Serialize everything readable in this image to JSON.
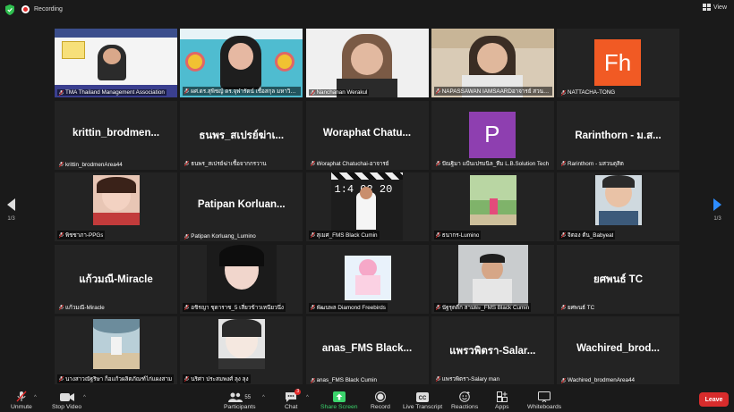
{
  "topbar": {
    "recording_label": "Recording",
    "view_label": "View"
  },
  "pager": {
    "left_label": "1/3",
    "right_label": "1/3"
  },
  "tiles": [
    {
      "label": "TMA Thailand Management Association",
      "kind": "video-presenter",
      "muted": true
    },
    {
      "label": "ผศ.ดร.สุพิชญ์ ดร.จุฬารัตน์ เชื้อสกุล มหาวิทยา...",
      "kind": "video-woman",
      "muted": true
    },
    {
      "label": "Nanchanan Werakul",
      "kind": "video-werakul",
      "muted": true
    },
    {
      "label": "NAPASSAWAN IAMSAARDอาจารย์ สวนดุสิต",
      "kind": "video-napassawan",
      "muted": true
    },
    {
      "label": "NATTACHA-TONG",
      "kind": "avatar",
      "avatar_text": "Fh",
      "avatar_color": "#f15a24",
      "muted": true
    },
    {
      "label": "krittin_brodmenArea44",
      "kind": "name",
      "big": "krittin_brodmen...",
      "muted": true
    },
    {
      "label": "ธนพร_สเปรย์ฆ่าเชื้อจากกรวาน",
      "kind": "name",
      "big": "ธนพร_สเปรย์ฆ่าเ...",
      "muted": true
    },
    {
      "label": "Woraphat Chatuchai-อาจารย์",
      "kind": "name",
      "big": "Woraphat  Chatu...",
      "muted": true
    },
    {
      "label": "ปัณฐิมา แป้นเปรมนิล_ทีม L.B.Solution Tech",
      "kind": "avatar",
      "avatar_text": "P",
      "avatar_color": "#8e3fb0",
      "muted": true
    },
    {
      "label": "Rarinthorn - มสวนดุสิต",
      "kind": "name",
      "big": "Rarinthorn - ม.ส...",
      "muted": true
    },
    {
      "label": "พิชชาภา-PPGs",
      "kind": "photo",
      "photo": "girl",
      "muted": true
    },
    {
      "label": "Patipan Korluang_Lumino",
      "kind": "name",
      "big": "Patipan  Korluan...",
      "muted": true
    },
    {
      "label": "สุเมศ_FMS Black Cumin",
      "kind": "photo",
      "photo": "clapper",
      "muted": true
    },
    {
      "label": "ธนากร-Lumino",
      "kind": "photo",
      "photo": "park",
      "muted": true
    },
    {
      "label": "จิตอง ต้น_Babyeat",
      "kind": "photo",
      "photo": "boy",
      "muted": true
    },
    {
      "label": "แก้วมณี-Miracle",
      "kind": "name",
      "big": "แก้วมณี-Miracle",
      "muted": true
    },
    {
      "label": "อชิรญา ชุดาราช_5 เสี่ยวข้าวเหนียวนึ่ง",
      "kind": "photo",
      "photo": "portrait",
      "muted": true
    },
    {
      "label": "พัฒนพล Diamond Freebirds",
      "kind": "photo",
      "photo": "pinkchar",
      "muted": true
    },
    {
      "label": "นัฐรุตติ์ก สามผะ_FMS Black Cumin",
      "kind": "photo",
      "photo": "man",
      "muted": true
    },
    {
      "label": "ยศพนธ์ TC",
      "kind": "name",
      "big": "ยศพนธ์ TC",
      "muted": true
    },
    {
      "label": "นางสาวณัฐริษา ก็อแก้วผลิตภัณฑ์ไก่แผงสาม",
      "kind": "photo",
      "photo": "beach",
      "muted": true
    },
    {
      "label": "นริศา ประสมพงศ์ ลุง ลุง",
      "kind": "photo",
      "photo": "anime",
      "muted": true
    },
    {
      "label": "anas_FMS Black Cumin",
      "kind": "name",
      "big": "anas_FMS  Black...",
      "muted": true
    },
    {
      "label": "แพรวพิตรา-Salary man",
      "kind": "name",
      "big": "แพรวพิตรา-Salar...",
      "muted": true
    },
    {
      "label": "Wachired_brodmenArea44",
      "kind": "name",
      "big": "Wachired_brod...",
      "muted": true
    }
  ],
  "toolbar": {
    "unmute": "Unmute",
    "stop_video": "Stop Video",
    "participants": "Participants",
    "participants_count": "55",
    "chat": "Chat",
    "chat_badge": "3",
    "share_screen": "Share Screen",
    "record": "Record",
    "live_transcript": "Live Transcript",
    "reactions": "Reactions",
    "apps": "Apps",
    "whiteboards": "Whiteboards",
    "leave": "Leave"
  },
  "colors": {
    "speaking_outline": "#c8e63c",
    "share_green": "#3bd46c",
    "leave_red": "#d82c2c",
    "muted_red": "#e02828"
  }
}
